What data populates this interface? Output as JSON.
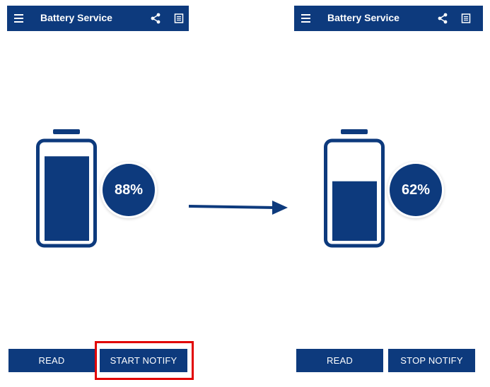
{
  "left_screen": {
    "app_bar": {
      "title": "Battery Service",
      "menu_icon": "hamburger-menu-icon",
      "share_icon": "share-icon",
      "log_icon": "document-icon"
    },
    "battery_level": 0.88,
    "battery_percent_label": "88%",
    "buttons": {
      "read_label": "READ",
      "notify_label": "START NOTIFY"
    }
  },
  "right_screen": {
    "app_bar": {
      "title": "Battery Service",
      "menu_icon": "hamburger-menu-icon",
      "share_icon": "share-icon",
      "log_icon": "document-icon"
    },
    "battery_level": 0.62,
    "battery_percent_label": "62%",
    "buttons": {
      "read_label": "READ",
      "notify_label": "STOP NOTIFY"
    }
  },
  "colors": {
    "primary": "#0d3a7d",
    "highlight": "#e10000",
    "background": "#ffffff"
  },
  "annotations": {
    "transition_arrow": "arrow-right-icon",
    "highlighted_button": "START NOTIFY"
  }
}
